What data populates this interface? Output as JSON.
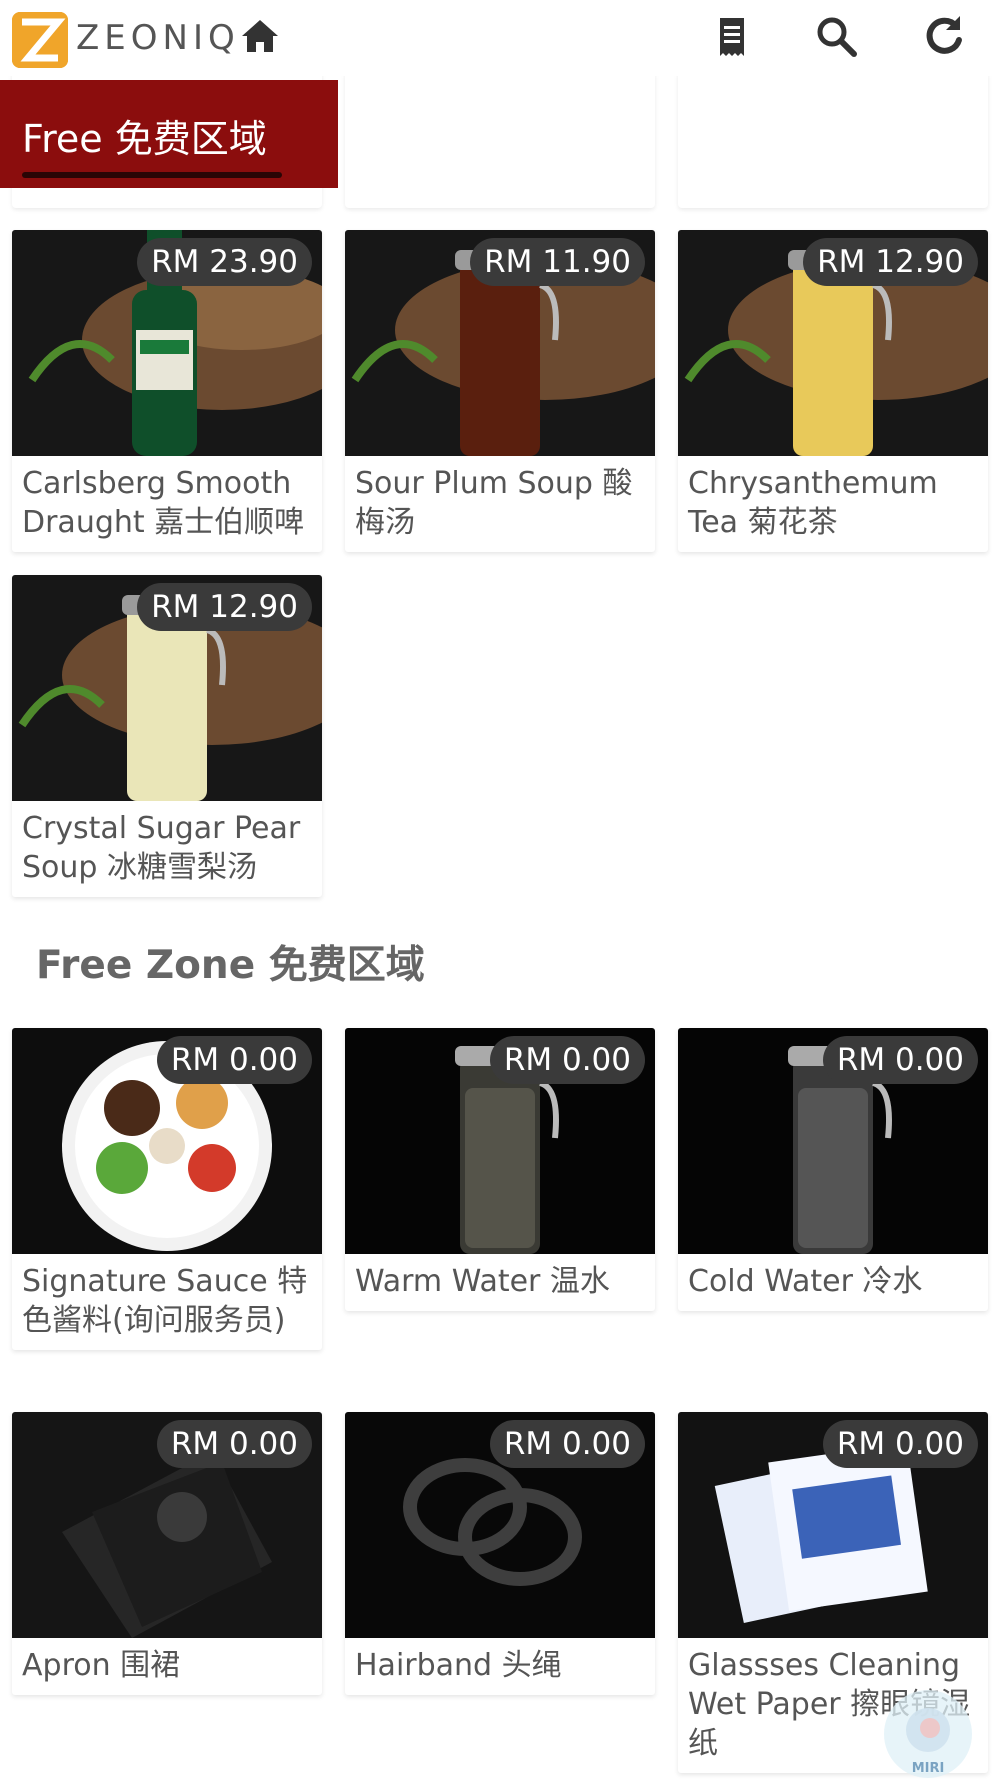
{
  "app": {
    "brand_name": "ZEONIQ",
    "accent_color": "#8b0d0d",
    "logo_color": "#f0a52a"
  },
  "header": {
    "icons": [
      "home-icon",
      "receipt-icon",
      "search-icon",
      "refresh-icon"
    ]
  },
  "category_tab": {
    "label": "Free 免费区域"
  },
  "products_top": [
    {
      "name": "Carlsberg Smooth Draught 嘉士伯顺啤",
      "price": "RM 23.90",
      "image": "beer-bottle"
    },
    {
      "name": "Sour Plum Soup 酸梅汤",
      "price": "RM 11.90",
      "image": "dark-drink-jug"
    },
    {
      "name": "Chrysanthemum Tea 菊花茶",
      "price": "RM 12.90",
      "image": "yellow-drink-jug"
    },
    {
      "name": "Crystal Sugar Pear Soup 冰糖雪梨汤",
      "price": "RM 12.90",
      "image": "pale-drink-jug"
    }
  ],
  "free_zone": {
    "title": "Free Zone 免费区域",
    "products": [
      {
        "name": "Signature Sauce 特色酱料(询问服务员)",
        "price": "RM 0.00",
        "image": "sauce-bowl"
      },
      {
        "name": "Warm Water 温水",
        "price": "RM 0.00",
        "image": "water-jug"
      },
      {
        "name": "Cold Water 冷水",
        "price": "RM 0.00",
        "image": "water-jug"
      },
      {
        "name": "Apron 围裙",
        "price": "RM 0.00",
        "image": "apron-pack"
      },
      {
        "name": "Hairband 头绳",
        "price": "RM 0.00",
        "image": "hairband"
      },
      {
        "name": "Glassses Cleaning Wet Paper 擦眼镜湿纸",
        "price": "RM 0.00",
        "image": "wet-wipes"
      }
    ]
  },
  "watermark": {
    "text": "MIRI"
  }
}
